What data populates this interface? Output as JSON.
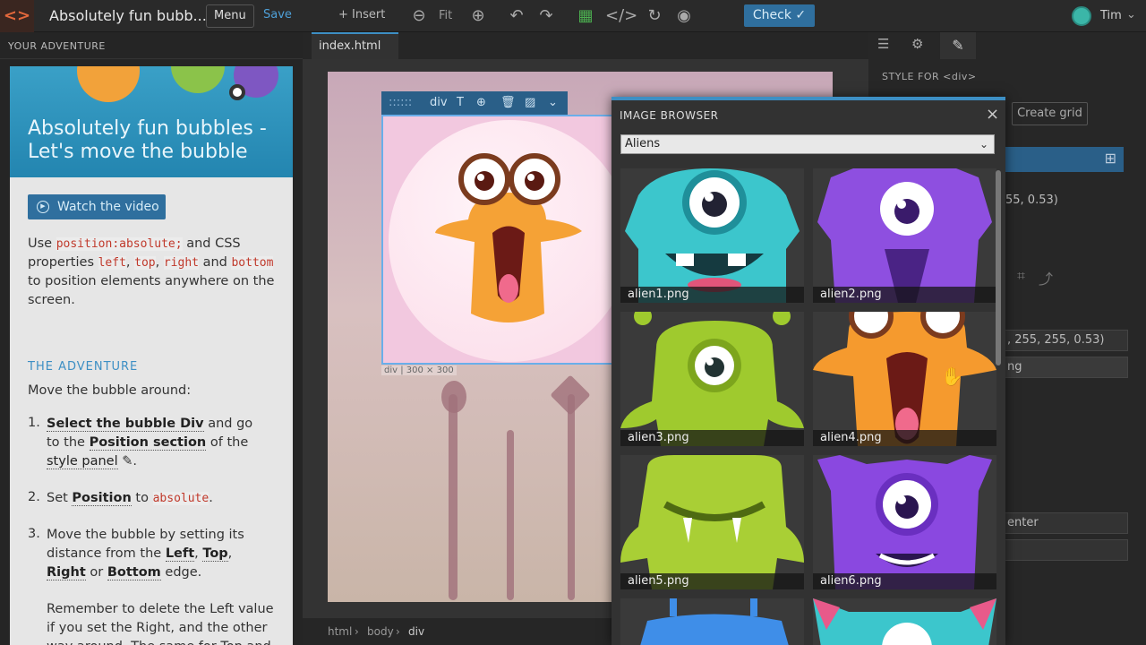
{
  "app": {
    "title": "Absolutely fun bubb...",
    "menu_label": "Menu",
    "save_label": "Save",
    "insert_label": "+ Insert",
    "fit_label": "Fit",
    "check_label": "Check ✓",
    "user_name": "Tim"
  },
  "left_panel": {
    "header": "YOUR ADVENTURE",
    "banner_title": "Absolutely fun bubbles - Let's move the bubble",
    "video_button": "Watch the video",
    "intro_1": "Use",
    "intro_code_1": "position:absolute;",
    "intro_2": "and CSS properties",
    "intro_code_left": "left",
    "intro_code_top": "top",
    "intro_code_right": "right",
    "intro_and": "and",
    "intro_code_bottom": "bottom",
    "intro_3": "to position elements anywhere on the screen.",
    "adventure_heading": "THE ADVENTURE",
    "adventure_intro": "Move the bubble around:",
    "step1_num": "1.",
    "step1_a": "Select the bubble Div",
    "step1_b": "and go to the",
    "step1_c": "Position section",
    "step1_d": "of the",
    "step1_e": "style panel",
    "step2_num": "2.",
    "step2_a": "Set",
    "step2_b": "Position",
    "step2_c": "to",
    "step2_code": "absolute",
    "step3_num": "3.",
    "step3_a": "Move the bubble by setting its distance from the",
    "step3_left": "Left",
    "step3_top": "Top",
    "step3_right": "Right",
    "step3_or": "or",
    "step3_bottom": "Bottom",
    "step3_edge": "edge.",
    "remember": "Remember to delete the Left value if you set the Right, and the other way around. The same for Top and Bottom."
  },
  "canvas": {
    "tab_label": "index.html",
    "toolbar_label": "div",
    "size_label": "div | 300 × 300",
    "breadcrumb": [
      "html",
      "body",
      "div"
    ]
  },
  "right_panel": {
    "style_for": "STYLE FOR  <div>",
    "create_grid": "Create grid",
    "partial_rgba_1": "55, 0.53)",
    "partial_rgba_2": ", 255, 255, 0.53)",
    "partial_bg": "ng",
    "partial_align": "enter"
  },
  "image_browser": {
    "title": "IMAGE BROWSER",
    "category": "Aliens",
    "images": [
      {
        "name": "alien1.png",
        "color": "#3cc6cc"
      },
      {
        "name": "alien2.png",
        "color": "#8e4fe0"
      },
      {
        "name": "alien3.png",
        "color": "#9fca2e"
      },
      {
        "name": "alien4.png",
        "color": "#f59a2e"
      },
      {
        "name": "alien5.png",
        "color": "#a9cf35"
      },
      {
        "name": "alien6.png",
        "color": "#8a48e0"
      }
    ]
  },
  "colors": {
    "accent": "#3d8fc4",
    "check_button": "#2f6f9e",
    "logo": "#e2683c"
  }
}
